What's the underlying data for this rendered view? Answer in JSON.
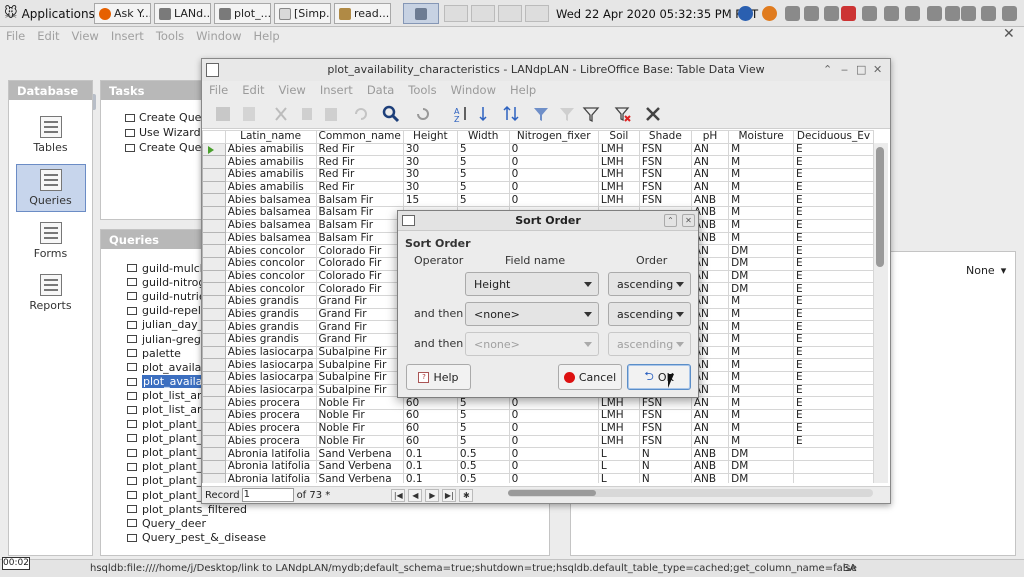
{
  "panel": {
    "applications_label": "Applications",
    "tasks": [
      {
        "label": "Ask Y..."
      },
      {
        "label": "LANd..."
      },
      {
        "label": "plot_..."
      },
      {
        "label": "[Simp..."
      },
      {
        "label": "read..."
      }
    ],
    "clock": "Wed 22 Apr 2020 05:32:35 PM PDT"
  },
  "main_menu": [
    "File",
    "Edit",
    "View",
    "Insert",
    "Tools",
    "Window",
    "Help"
  ],
  "database_panel": {
    "title": "Database",
    "items": [
      {
        "label": "Tables"
      },
      {
        "label": "Queries",
        "selected": true
      },
      {
        "label": "Forms"
      },
      {
        "label": "Reports"
      }
    ]
  },
  "tasks_panel": {
    "title": "Tasks",
    "items": [
      "Create Quer",
      "Use Wizard t",
      "Create Quer"
    ]
  },
  "queries_panel": {
    "title": "Queries",
    "items": [
      "guild-mulch",
      "guild-nitroge",
      "guild-nutrien",
      "guild-repelle",
      "julian_day_t",
      "julian-gregor",
      "palette",
      "plot_availab",
      "plot_availab",
      "plot_list_and",
      "plot_list_and",
      "plot_plant_a",
      "plot_plant_c",
      "plot_plant_c",
      "plot_plant_le",
      "plot_plant_n",
      "plot_plant_s",
      "plot_plants_filtered",
      "Query_deer",
      "Query_pest_&_disease"
    ],
    "selected_index": 8
  },
  "right_panel": {
    "none_label": "None"
  },
  "status_bar": "hsqldb:file:////home/j/Desktop/link to LANdpLAN/mydb;default_schema=true;shutdown=true;hsqldb.default_table_type=cached;get_column_name=false",
  "status_bar_right": "SA",
  "table_window": {
    "title": "plot_availability_characteristics - LANdpLAN - LibreOffice Base: Table Data View",
    "menu": [
      "File",
      "Edit",
      "View",
      "Insert",
      "Data",
      "Tools",
      "Window",
      "Help"
    ],
    "columns": [
      "Latin_name",
      "Common_name",
      "Height",
      "Width",
      "Nitrogen_fixer",
      "Soil",
      "Shade",
      "pH",
      "Moisture",
      "Deciduous_Ev"
    ],
    "rows": [
      [
        "Abies amabilis",
        "Red Fir",
        "30",
        "5",
        "0",
        "LMH",
        "FSN",
        "AN",
        "M",
        "E"
      ],
      [
        "Abies amabilis",
        "Red Fir",
        "30",
        "5",
        "0",
        "LMH",
        "FSN",
        "AN",
        "M",
        "E"
      ],
      [
        "Abies amabilis",
        "Red Fir",
        "30",
        "5",
        "0",
        "LMH",
        "FSN",
        "AN",
        "M",
        "E"
      ],
      [
        "Abies amabilis",
        "Red Fir",
        "30",
        "5",
        "0",
        "LMH",
        "FSN",
        "AN",
        "M",
        "E"
      ],
      [
        "Abies balsamea",
        "Balsam Fir",
        "15",
        "5",
        "0",
        "LMH",
        "FSN",
        "ANB",
        "M",
        "E"
      ],
      [
        "Abies balsamea",
        "Balsam Fir",
        "",
        "",
        "",
        "",
        "",
        "ANB",
        "M",
        "E"
      ],
      [
        "Abies balsamea",
        "Balsam Fir",
        "",
        "",
        "",
        "",
        "",
        "ANB",
        "M",
        "E"
      ],
      [
        "Abies balsamea",
        "Balsam Fir",
        "",
        "",
        "",
        "",
        "",
        "ANB",
        "M",
        "E"
      ],
      [
        "Abies concolor",
        "Colorado Fir",
        "",
        "",
        "",
        "",
        "",
        "AN",
        "DM",
        "E"
      ],
      [
        "Abies concolor",
        "Colorado Fir",
        "",
        "",
        "",
        "",
        "",
        "AN",
        "DM",
        "E"
      ],
      [
        "Abies concolor",
        "Colorado Fir",
        "",
        "",
        "",
        "",
        "",
        "AN",
        "DM",
        "E"
      ],
      [
        "Abies concolor",
        "Colorado Fir",
        "",
        "",
        "",
        "",
        "",
        "AN",
        "DM",
        "E"
      ],
      [
        "Abies grandis",
        "Grand Fir",
        "",
        "",
        "",
        "",
        "",
        "AN",
        "M",
        "E"
      ],
      [
        "Abies grandis",
        "Grand Fir",
        "",
        "",
        "",
        "",
        "",
        "AN",
        "M",
        "E"
      ],
      [
        "Abies grandis",
        "Grand Fir",
        "",
        "",
        "",
        "",
        "",
        "AN",
        "M",
        "E"
      ],
      [
        "Abies grandis",
        "Grand Fir",
        "",
        "",
        "",
        "",
        "",
        "AN",
        "M",
        "E"
      ],
      [
        "Abies lasiocarpa",
        "Subalpine Fir",
        "",
        "",
        "",
        "",
        "",
        "AN",
        "M",
        "E"
      ],
      [
        "Abies lasiocarpa",
        "Subalpine Fir",
        "",
        "",
        "",
        "",
        "",
        "AN",
        "M",
        "E"
      ],
      [
        "Abies lasiocarpa",
        "Subalpine Fir",
        "",
        "",
        "",
        "",
        "",
        "AN",
        "M",
        "E"
      ],
      [
        "Abies lasiocarpa",
        "Subalpine Fir",
        "",
        "",
        "",
        "",
        "",
        "AN",
        "M",
        "E"
      ],
      [
        "Abies procera",
        "Noble Fir",
        "60",
        "5",
        "0",
        "LMH",
        "FSN",
        "AN",
        "M",
        "E"
      ],
      [
        "Abies procera",
        "Noble Fir",
        "60",
        "5",
        "0",
        "LMH",
        "FSN",
        "AN",
        "M",
        "E"
      ],
      [
        "Abies procera",
        "Noble Fir",
        "60",
        "5",
        "0",
        "LMH",
        "FSN",
        "AN",
        "M",
        "E"
      ],
      [
        "Abies procera",
        "Noble Fir",
        "60",
        "5",
        "0",
        "LMH",
        "FSN",
        "AN",
        "M",
        "E"
      ],
      [
        "Abronia latifolia",
        "Sand Verbena",
        "0.1",
        "0.5",
        "0",
        "L",
        "N",
        "ANB",
        "DM",
        ""
      ],
      [
        "Abronia latifolia",
        "Sand Verbena",
        "0.1",
        "0.5",
        "0",
        "L",
        "N",
        "ANB",
        "DM",
        ""
      ],
      [
        "Abronia latifolia",
        "Sand Verbena",
        "0.1",
        "0.5",
        "0",
        "L",
        "N",
        "ANB",
        "DM",
        ""
      ]
    ],
    "record_label": "Record",
    "record_value": "1",
    "record_of": "of 73 *"
  },
  "sort_dialog": {
    "title": "Sort Order",
    "heading": "Sort Order",
    "col_operator": "Operator",
    "col_field": "Field name",
    "col_order": "Order",
    "rows": [
      {
        "operator": "",
        "field": "Height",
        "order": "ascending",
        "enabled": true
      },
      {
        "operator": "and then",
        "field": "<none>",
        "order": "ascending",
        "enabled": true
      },
      {
        "operator": "and then",
        "field": "<none>",
        "order": "ascending",
        "enabled": false
      }
    ],
    "help_label": "Help",
    "cancel_label": "Cancel",
    "ok_label": "OK"
  },
  "timer": "00:02",
  "colors": {
    "selection": "#3c6fc0",
    "panel_header": "#b8b8b8"
  }
}
